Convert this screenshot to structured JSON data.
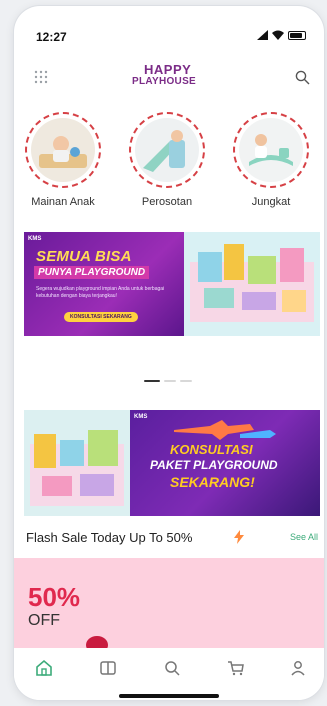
{
  "status_bar": {
    "time": "12:27"
  },
  "header": {
    "logo_line1": "HAPPY",
    "logo_line2": "PLAYHOUSE"
  },
  "categories": [
    {
      "label": "Mainan Anak"
    },
    {
      "label": "Perosotan"
    },
    {
      "label": "Jungkat"
    }
  ],
  "banner1": {
    "brand": "KMS",
    "title_line1": "SEMUA BISA",
    "title_line2": "PUNYA PLAYGROUND",
    "subtitle": "Segera wujudkan playground impian Anda untuk berbagai kebutuhan dengan biaya terjangkau!",
    "cta": "KONSULTASI SEKARANG"
  },
  "banner2": {
    "brand": "KMS",
    "line1": "KONSULTASI",
    "line2": "PAKET PLAYGROUND",
    "line3": "SEKARANG!"
  },
  "flash_sale": {
    "title": "Flash Sale Today Up To 50%",
    "see_all": "See All"
  },
  "promo": {
    "percent": "50%",
    "off": "OFF"
  },
  "colors": {
    "brand": "#7b2c87",
    "accent_green": "#3cab7a",
    "promo_bg": "#fdd0de",
    "promo_red": "#e0294e"
  },
  "tab_bar": {
    "icons": [
      "home-icon",
      "catalog-icon",
      "search-icon",
      "cart-icon",
      "profile-icon"
    ],
    "active": "home-icon"
  }
}
